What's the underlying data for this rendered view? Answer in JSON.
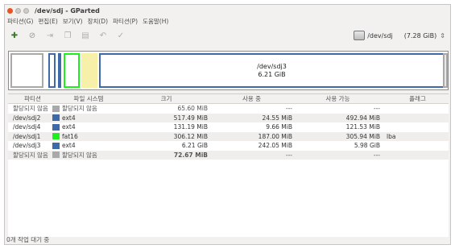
{
  "window": {
    "title": "/dev/sdj - GParted"
  },
  "menubar": {
    "items": [
      "파티션(G)",
      "편집(E)",
      "보기(V)",
      "장치(D)",
      "파티션(P)",
      "도움말(H)"
    ]
  },
  "toolbar": {
    "buttons": [
      {
        "name": "new-partition",
        "icon": "new-icon",
        "enabled": true
      },
      {
        "name": "delete",
        "icon": "no-entry-icon",
        "enabled": false
      },
      {
        "name": "resize-move",
        "icon": "resize-icon",
        "enabled": false
      },
      {
        "name": "copy",
        "icon": "copy-icon",
        "enabled": false
      },
      {
        "name": "paste",
        "icon": "paste-icon",
        "enabled": false
      },
      {
        "name": "undo",
        "icon": "undo-icon",
        "enabled": false
      },
      {
        "name": "apply",
        "icon": "check-icon",
        "enabled": false
      }
    ],
    "device": {
      "name": "/dev/sdj",
      "size": "(7.28 GiB)"
    }
  },
  "partition_bar": {
    "selected_name": "/dev/sdj3",
    "selected_size": "6.21 GiB"
  },
  "table": {
    "headers": [
      "파티션",
      "파일 시스템",
      "크기",
      "사용 중",
      "사용 가능",
      "플래그"
    ],
    "rows": [
      {
        "partition": "할당되지 않음",
        "fs": "할당되지 않음",
        "fs_color": "#a9a9a9",
        "size": "65.60 MiB",
        "used": "---",
        "free": "---",
        "flags": "",
        "bold_size": false
      },
      {
        "partition": "/dev/sdj2",
        "fs": "ext4",
        "fs_color": "#3e6aa7",
        "size": "517.49 MiB",
        "used": "24.55 MiB",
        "free": "492.94 MiB",
        "flags": "",
        "bold_size": false
      },
      {
        "partition": "/dev/sdj4",
        "fs": "ext4",
        "fs_color": "#3e6aa7",
        "size": "131.19 MiB",
        "used": "9.66 MiB",
        "free": "121.53 MiB",
        "flags": "",
        "bold_size": false
      },
      {
        "partition": "/dev/sdj1",
        "fs": "fat16",
        "fs_color": "#1ef01e",
        "size": "306.12 MiB",
        "used": "187.00 MiB",
        "free": "305.94 MiB",
        "flags": "lba",
        "bold_size": false
      },
      {
        "partition": "/dev/sdj3",
        "fs": "ext4",
        "fs_color": "#3e6aa7",
        "size": "6.21 GiB",
        "used": "242.05 MiB",
        "free": "5.98 GiB",
        "flags": "",
        "bold_size": false
      },
      {
        "partition": "할당되지 않음",
        "fs": "할당되지 않음",
        "fs_color": "#a9a9a9",
        "size": "72.67 MiB",
        "used": "---",
        "free": "---",
        "flags": "",
        "bold_size": true
      }
    ]
  },
  "statusbar": {
    "text": "0개 작업 대기 중"
  }
}
